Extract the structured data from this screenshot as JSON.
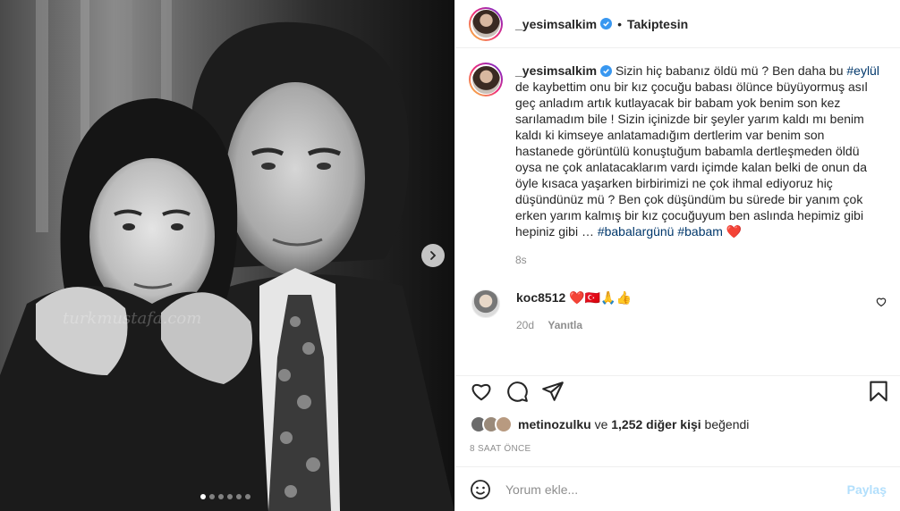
{
  "post": {
    "author": "_yesimsalkim",
    "follow_status": "Takiptesin",
    "separator": "•",
    "image_dots": 6,
    "active_dot": 0,
    "watermark": "turkmustafa.com"
  },
  "caption": {
    "username": "_yesimsalkim",
    "text_1": "Sizin hiç babanız öldü mü ? Ben daha bu ",
    "hashtag_1": "#eylül",
    "text_2": " de kaybettim onu bir kız çocuğu babası ölünce büyüyormuş asıl geç anladım artık kutlayacak bir babam yok benim son kez sarılamadım bile ! Sizin içinizde bir şeyler yarım kaldı mı benim kaldı ki kimseye anlatamadığım dertlerim var benim son hastanede görüntülü konuştuğum babamla dertleşmeden öldü oysa ne çok anlatacaklarım vardı içimde kalan belki de onun da öyle kısaca yaşarken birbirimizi ne çok ihmal ediyoruz hiç düşündünüz mü ? Ben çok düşündüm bu sürede bir yanım çok erken yarım kalmış bir kız çocuğuyum ben aslında hepimiz gibi hepiniz gibi … ",
    "hashtag_2": "#babalargünü",
    "hashtag_3": "#babam",
    "emoji": "❤️",
    "age": "8s"
  },
  "comment": {
    "username": "koc8512",
    "text": "❤️🇹🇷🙏👍",
    "age": "20d",
    "reply_label": "Yanıtla"
  },
  "likes": {
    "user": "metinozulku",
    "connector": "ve",
    "others": "1,252 diğer kişi",
    "suffix": "beğendi"
  },
  "timestamp": "8 SAAT ÖNCE",
  "add_comment": {
    "placeholder": "Yorum ekle...",
    "share_label": "Paylaş"
  },
  "colors": {
    "link": "#00376b",
    "muted": "#8e8e8e",
    "share_disabled": "#b2dffc",
    "heart": "#ed4956",
    "verified": "#3897f0"
  }
}
